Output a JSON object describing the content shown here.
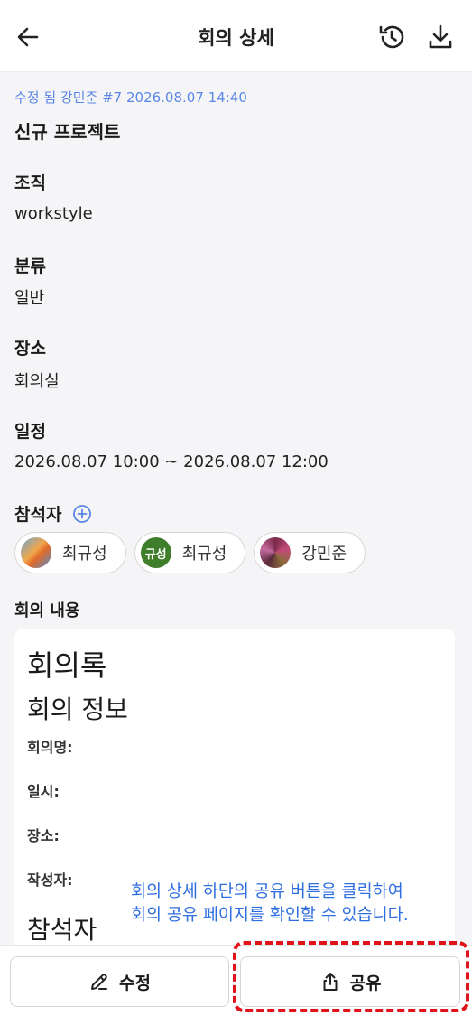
{
  "header": {
    "title": "회의 상세"
  },
  "meta": {
    "edited_text": "수정 됨 강민준 #7 2026.08.07 14:40"
  },
  "project_title": "신규 프로젝트",
  "fields": {
    "org_label": "조직",
    "org_value": "workstyle",
    "category_label": "분류",
    "category_value": "일반",
    "place_label": "장소",
    "place_value": "회의실",
    "schedule_label": "일정",
    "schedule_value": "2026.08.07 10:00 ~ 2026.08.07 12:00",
    "attendees_label": "참석자"
  },
  "attendees": [
    {
      "name": "최규성",
      "avatar_text": ""
    },
    {
      "name": "최규성",
      "avatar_text": "규성"
    },
    {
      "name": "강민준",
      "avatar_text": ""
    }
  ],
  "meeting": {
    "label": "회의 내용",
    "heading1": "회의록",
    "heading2": "회의 정보",
    "field_name": "회의명:",
    "field_date": "일시:",
    "field_place": "장소:",
    "field_author": "작성자:",
    "heading3": "참석자"
  },
  "tip": {
    "line1": "회의 상세 하단의 공유 버튼을 클릭하여",
    "line2": "회의 공유 페이지를 확인할 수 있습니다."
  },
  "bottom": {
    "edit_label": "수정",
    "share_label": "공유"
  },
  "colors": {
    "accent": "#5a86e6",
    "tip": "#2f6ee0",
    "highlight": "#e0121a"
  }
}
